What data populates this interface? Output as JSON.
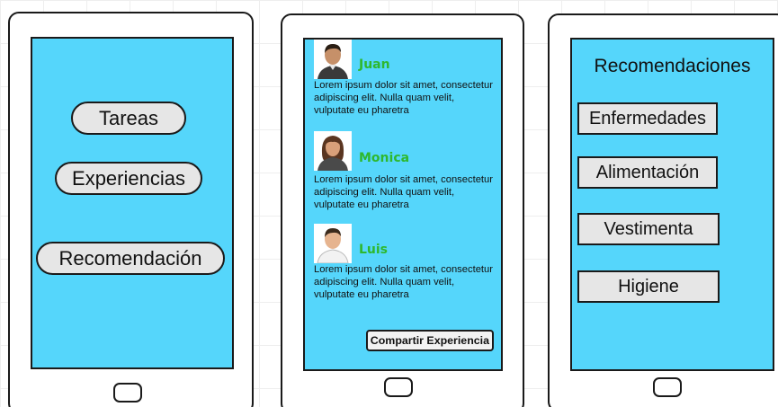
{
  "colors": {
    "screen": "#55d6fb",
    "button": "#e6e6e6",
    "name": "#2eb82e",
    "outline": "#1a1a1a"
  },
  "menu": {
    "tasks": "Tareas",
    "experiences": "Experiencias",
    "recommendation": "Recomendación"
  },
  "experiences": {
    "posts": [
      {
        "name": "Juan",
        "avatar_icon": "man-avatar-icon",
        "text": "Lorem ipsum dolor sit amet, consectetur adipiscing elit. Nulla quam velit, vulputate eu pharetra"
      },
      {
        "name": "Monica",
        "avatar_icon": "woman-avatar-icon",
        "text": "Lorem ipsum dolor sit amet, consectetur adipiscing elit. Nulla quam velit, vulputate eu pharetra"
      },
      {
        "name": "Luis",
        "avatar_icon": "man-avatar-icon",
        "text": "Lorem ipsum dolor sit amet, consectetur adipiscing elit. Nulla quam velit, vulputate eu pharetra"
      }
    ],
    "share_label": "Compartir Experiencia"
  },
  "recommendations": {
    "title": "Recomendaciones",
    "items": [
      "Enfermedades",
      "Alimentación",
      "Vestimenta",
      "Higiene"
    ]
  }
}
